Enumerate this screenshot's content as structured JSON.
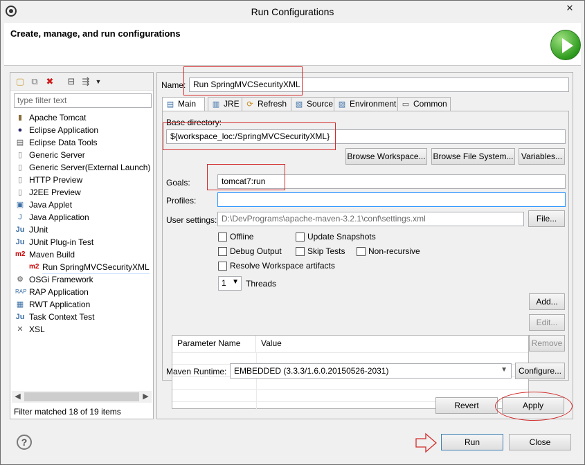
{
  "window": {
    "title": "Run Configurations",
    "close_glyph": "✕"
  },
  "header": {
    "title": "Create, manage, and run configurations",
    "icon": "run-icon"
  },
  "left": {
    "toolbar_icons": [
      "new-config-icon",
      "duplicate-icon",
      "delete-icon",
      "collapse-all-icon",
      "filter-icon",
      "dropdown-icon"
    ],
    "filter_placeholder": "type filter text",
    "tree": [
      {
        "label": "Apache Tomcat",
        "icon": "tomcat-icon"
      },
      {
        "label": "Eclipse Application",
        "icon": "eclipse-icon"
      },
      {
        "label": "Eclipse Data Tools",
        "icon": "data-tools-icon"
      },
      {
        "label": "Generic Server",
        "icon": "server-icon"
      },
      {
        "label": "Generic Server(External Launch)",
        "icon": "server-icon"
      },
      {
        "label": "HTTP Preview",
        "icon": "server-icon"
      },
      {
        "label": "J2EE Preview",
        "icon": "server-icon"
      },
      {
        "label": "Java Applet",
        "icon": "applet-icon"
      },
      {
        "label": "Java Application",
        "icon": "java-app-icon"
      },
      {
        "label": "JUnit",
        "icon": "junit-icon"
      },
      {
        "label": "JUnit Plug-in Test",
        "icon": "junit-plugin-icon"
      },
      {
        "label": "Maven Build",
        "icon": "maven-icon"
      },
      {
        "label": "Run SpringMVCSecurityXML",
        "icon": "maven-icon",
        "child": true
      },
      {
        "label": "OSGi Framework",
        "icon": "osgi-icon"
      },
      {
        "label": "RAP Application",
        "icon": "rap-icon"
      },
      {
        "label": "RWT Application",
        "icon": "rwt-icon"
      },
      {
        "label": "Task Context Test",
        "icon": "task-icon"
      },
      {
        "label": "XSL",
        "icon": "xsl-icon"
      }
    ],
    "filter_status": "Filter matched 18 of 19 items"
  },
  "main": {
    "name_label": "Name:",
    "name_value": "Run SpringMVCSecurityXML",
    "tabs": [
      {
        "label": "Main",
        "icon": "main-tab-icon"
      },
      {
        "label": "JRE",
        "icon": "jre-icon"
      },
      {
        "label": "Refresh",
        "icon": "refresh-icon"
      },
      {
        "label": "Source",
        "icon": "source-icon"
      },
      {
        "label": "Environment",
        "icon": "environment-icon"
      },
      {
        "label": "Common",
        "icon": "common-icon"
      }
    ],
    "base_dir_label": "Base directory:",
    "base_dir_value": "${workspace_loc:/SpringMVCSecurityXML}",
    "browse_workspace": "Browse Workspace...",
    "browse_fs": "Browse File System...",
    "variables": "Variables...",
    "goals_label": "Goals:",
    "goals_value": "tomcat7:run",
    "profiles_label": "Profiles:",
    "profiles_value": "",
    "user_settings_label": "User settings:",
    "user_settings_value": "D:\\DevPrograms\\apache-maven-3.2.1\\conf\\settings.xml",
    "file_button": "File...",
    "checkboxes": {
      "offline": "Offline",
      "update_snapshots": "Update Snapshots",
      "debug_output": "Debug Output",
      "skip_tests": "Skip Tests",
      "non_recursive": "Non-recursive",
      "resolve_workspace": "Resolve Workspace artifacts"
    },
    "threads_value": "1",
    "threads_label": "Threads",
    "param_headers": [
      "Parameter Name",
      "Value"
    ],
    "add_button": "Add...",
    "edit_button": "Edit...",
    "remove_button": "Remove",
    "runtime_label": "Maven Runtime:",
    "runtime_value": "EMBEDDED (3.3.3/1.6.0.20150526-2031)",
    "configure_button": "Configure...",
    "revert_button": "Revert",
    "apply_button": "Apply"
  },
  "footer": {
    "help_glyph": "?",
    "run_button": "Run",
    "close_button": "Close"
  },
  "annotation_color": "#d32a2a"
}
